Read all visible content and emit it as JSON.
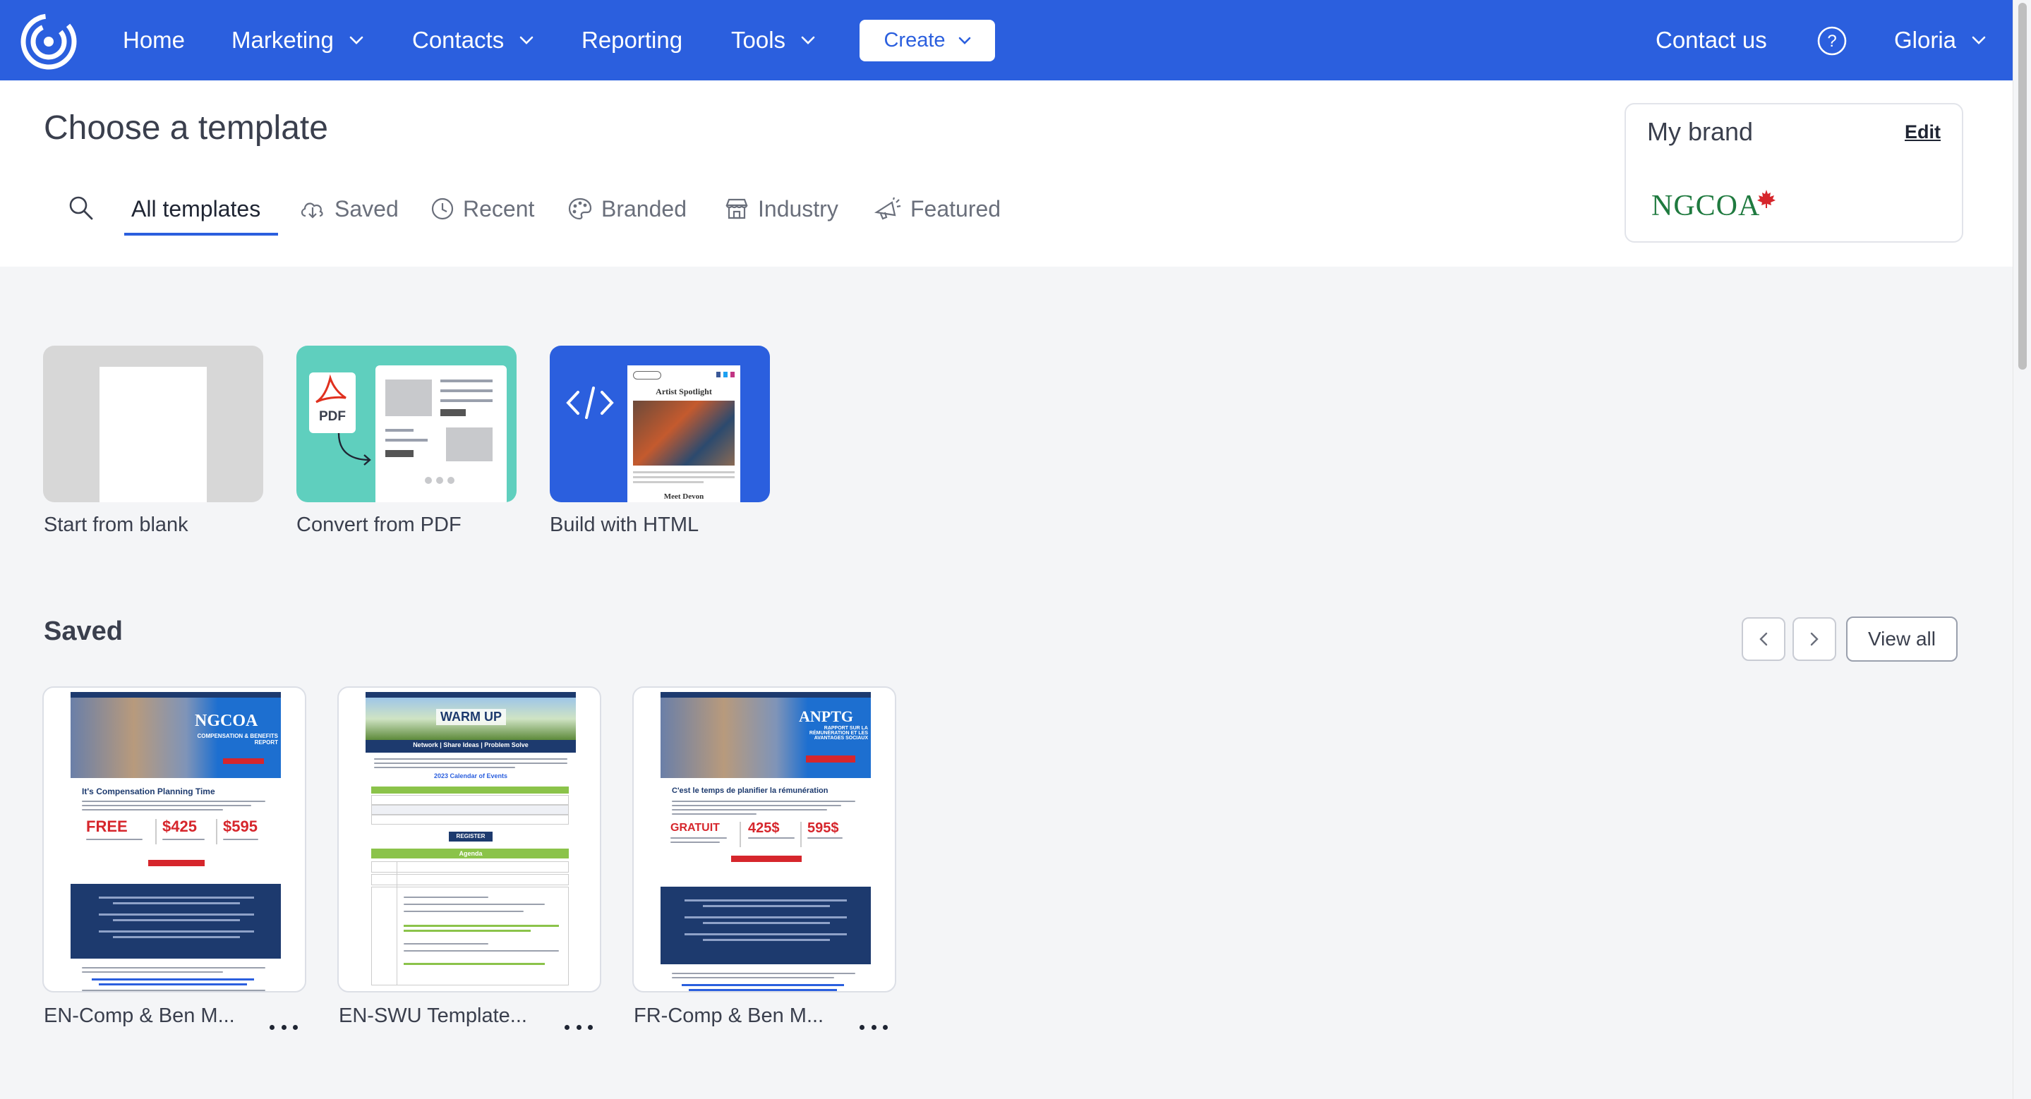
{
  "nav": {
    "items": [
      {
        "label": "Home"
      },
      {
        "label": "Marketing"
      },
      {
        "label": "Contacts"
      },
      {
        "label": "Reporting"
      },
      {
        "label": "Tools"
      }
    ],
    "create_label": "Create",
    "contact_label": "Contact us",
    "user_label": "Gloria"
  },
  "page": {
    "title": "Choose a template"
  },
  "tabs": [
    {
      "label": "All templates",
      "icon": "none",
      "active": true
    },
    {
      "label": "Saved",
      "icon": "cloud-download-icon"
    },
    {
      "label": "Recent",
      "icon": "clock-icon"
    },
    {
      "label": "Branded",
      "icon": "palette-icon"
    },
    {
      "label": "Industry",
      "icon": "storefront-icon"
    },
    {
      "label": "Featured",
      "icon": "megaphone-icon"
    }
  ],
  "brand": {
    "title": "My brand",
    "edit_label": "Edit",
    "logo_text": "NGCOA"
  },
  "start_options": [
    {
      "label": "Start from blank"
    },
    {
      "label": "Convert from PDF",
      "badge": "PDF"
    },
    {
      "label": "Build with HTML",
      "preview_heading": "Artist Spotlight",
      "preview_footer": "Meet Devon"
    }
  ],
  "saved": {
    "title": "Saved",
    "view_all_label": "View all",
    "templates": [
      {
        "name": "EN-Comp & Ben M...",
        "thumb": {
          "brand": "NGCOA",
          "subtitle": "COMPENSATION & BENEFITS REPORT",
          "headline": "It's Compensation Planning Time",
          "price_1": "FREE",
          "price_2": "$425",
          "price_3": "$595"
        }
      },
      {
        "name": "EN-SWU Template...",
        "thumb": {
          "banner": "WARM UP",
          "strap": "Network | Share Ideas | Problem Solve",
          "heading": "2023 Calendar of Events",
          "button": "REGISTER",
          "agenda": "Agenda"
        }
      },
      {
        "name": "FR-Comp & Ben M...",
        "thumb": {
          "brand": "ANPTG",
          "subtitle": "RAPPORT SUR LA RÉMUNÉRATION ET LES AVANTAGES SOCIAUX",
          "headline": "C'est le temps de planifier la rémunération",
          "price_1": "GRATUIT",
          "price_2": "425$",
          "price_3": "595$"
        }
      }
    ]
  },
  "colors": {
    "nav_blue": "#2b5fde",
    "pdf_teal": "#5fcfbe",
    "brand_green": "#1f7a3f",
    "maple_red": "#d6262c",
    "report_navy": "#1d3a6e",
    "price_red": "#d6262c",
    "swu_green": "#8bc34a"
  }
}
